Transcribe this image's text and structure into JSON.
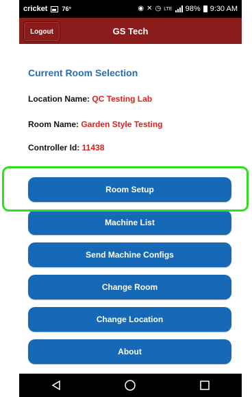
{
  "status_bar": {
    "carrier": "cricket",
    "temperature": "76°",
    "network": "LTE",
    "battery": "98%",
    "time": "9:30 AM"
  },
  "header": {
    "title": "GS Tech",
    "logout_label": "Logout"
  },
  "selection": {
    "heading": "Current Room Selection",
    "location_label": "Location Name:",
    "location_value": "QC Testing Lab",
    "room_label": "Room Name:",
    "room_value": "Garden Style Testing",
    "controller_label": "Controller Id:",
    "controller_value": "11438"
  },
  "menu": {
    "room_setup": "Room Setup",
    "machine_list": "Machine List",
    "send_configs": "Send Machine Configs",
    "change_room": "Change Room",
    "change_location": "Change Location",
    "about": "About"
  },
  "colors": {
    "header_bg": "#8b1c1c",
    "button_bg": "#1669b6",
    "heading": "#2a6cb0",
    "value_red": "#e0201a",
    "highlight": "#33dd22"
  },
  "icons": {
    "back": "back-triangle-icon",
    "home": "home-circle-icon",
    "recents": "recents-square-icon"
  }
}
